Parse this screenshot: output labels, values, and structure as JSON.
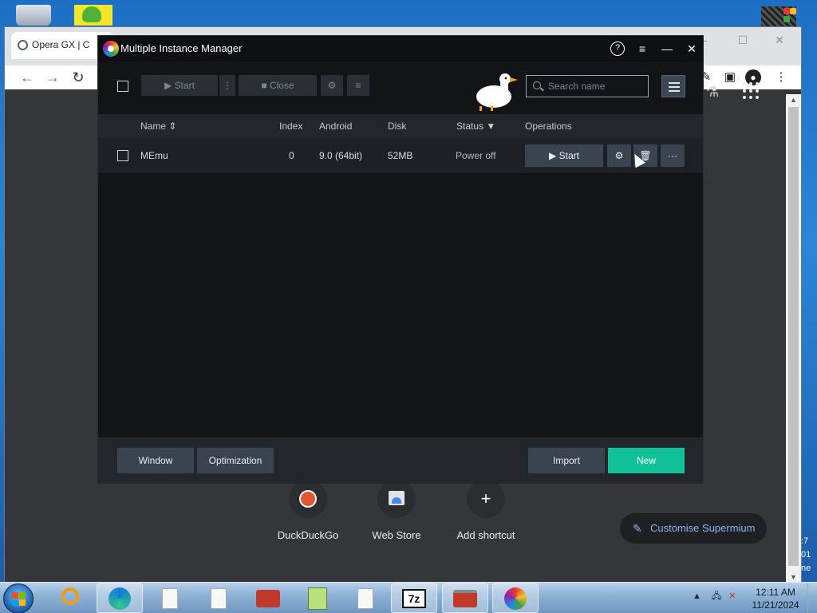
{
  "desktop": {
    "partial_text_right": [
      ":7",
      "01",
      "ne"
    ]
  },
  "browser": {
    "tab_title": "Opera GX | C",
    "window_controls": {
      "minimize": "—",
      "maximize": "☐",
      "close": "✕"
    },
    "nav": {
      "back": "←",
      "forward": "→",
      "reload": "↻"
    },
    "shortcuts": [
      {
        "label": "DuckDuckGo",
        "icon": "duckduckgo-icon"
      },
      {
        "label": "Web Store",
        "icon": "web-store-icon"
      },
      {
        "label": "Add shortcut",
        "icon": "plus-icon",
        "glyph": "+"
      }
    ],
    "customise_label": "Customise Supermium"
  },
  "mim": {
    "title": "Multiple Instance Manager",
    "title_controls": {
      "help": "?",
      "menu": "≡",
      "minimize": "—",
      "close": "✕"
    },
    "toolbar": {
      "start_label": "▶ Start",
      "more_glyph": "⋮",
      "close_label": "■ Close",
      "settings_glyph": "⚙",
      "list_glyph": "≡",
      "search_placeholder": "Search name"
    },
    "columns": {
      "name": "Name ⇕",
      "index": "Index",
      "android": "Android",
      "disk": "Disk",
      "status": "Status ▼",
      "operations": "Operations"
    },
    "instances": [
      {
        "name": "MEmu",
        "index": "0",
        "android": "9.0 (64bit)",
        "disk": "52MB",
        "status": "Power off",
        "start_label": "▶ Start",
        "settings_glyph": "⚙",
        "delete_glyph": "🗑",
        "more_glyph": "···"
      }
    ],
    "footer": {
      "window_label": "Window",
      "optimization_label": "Optimization",
      "import_label": "Import",
      "new_label": "New"
    },
    "colors": {
      "accent": "#10c29a",
      "background": "#121417",
      "header": "#23272c"
    }
  },
  "taskbar": {
    "apps": [
      "search-app-icon",
      "edge-icon",
      "blank-file-icon",
      "blank-file-icon",
      "toolbox-icon",
      "notepad-plus-icon",
      "blank-file-icon",
      "7zip-icon",
      "toolbox-red-icon",
      "memu-icon"
    ],
    "sevenzip_label": "7z",
    "clock_time": "12:11 AM",
    "clock_date": "11/21/2024"
  }
}
